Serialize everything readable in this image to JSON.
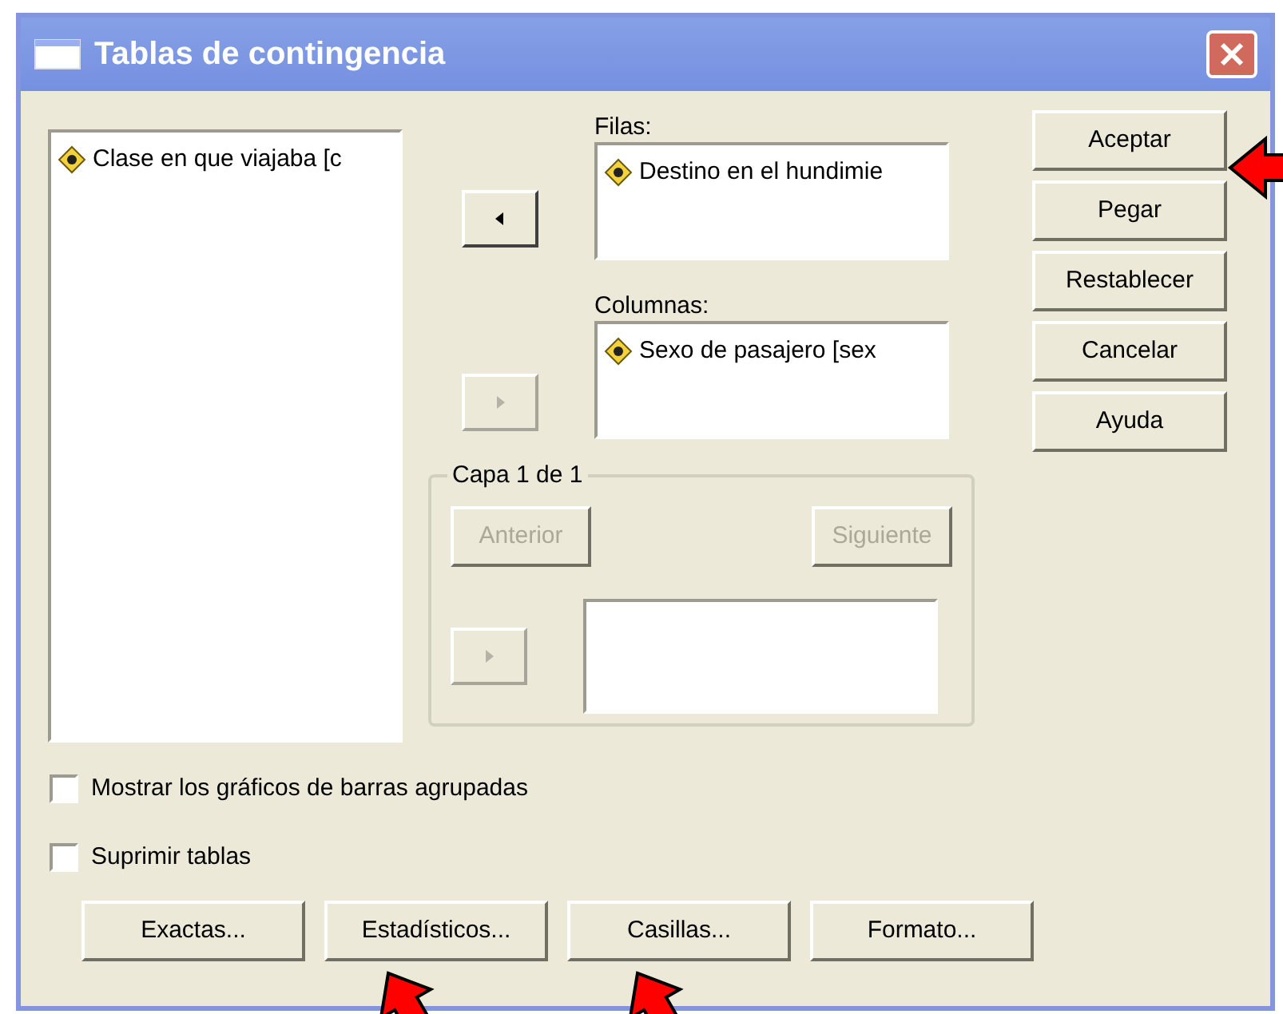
{
  "window": {
    "title": "Tablas de contingencia"
  },
  "variables": [
    {
      "label": "Clase en que viajaba [c"
    }
  ],
  "rows": {
    "label": "Filas:",
    "move_button": {
      "kind": "left",
      "disabled": false
    },
    "items": [
      {
        "label": "Destino en el hundimie"
      }
    ]
  },
  "columns": {
    "label": "Columnas:",
    "move_button": {
      "kind": "right",
      "disabled": true
    },
    "items": [
      {
        "label": "Sexo de pasajero [sex"
      }
    ]
  },
  "layer": {
    "title": "Capa 1 de 1",
    "previous": {
      "label": "Anterior",
      "disabled": true
    },
    "next": {
      "label": "Siguiente",
      "disabled": true
    },
    "move_button": {
      "kind": "right",
      "disabled": true
    }
  },
  "actions": [
    {
      "label": "Aceptar"
    },
    {
      "label": "Pegar"
    },
    {
      "label": "Restablecer"
    },
    {
      "label": "Cancelar"
    },
    {
      "label": "Ayuda"
    }
  ],
  "options": [
    {
      "label": "Mostrar los gráficos de barras agrupadas",
      "checked": false
    },
    {
      "label": "Suprimir tablas",
      "checked": false
    }
  ],
  "bottom_buttons": [
    {
      "label": "Exactas..."
    },
    {
      "label": "Estadísticos..."
    },
    {
      "label": "Casillas..."
    },
    {
      "label": "Formato..."
    }
  ]
}
